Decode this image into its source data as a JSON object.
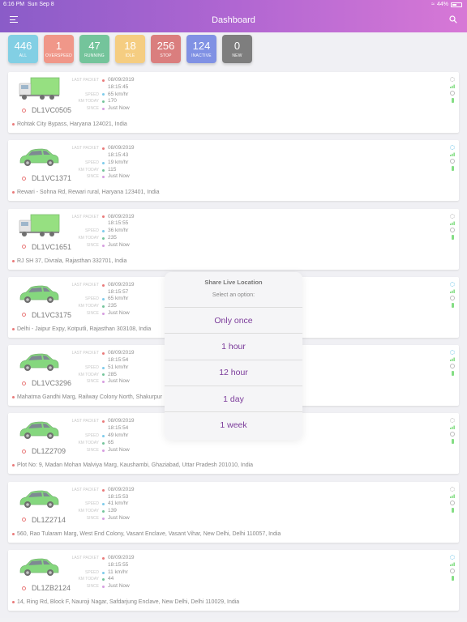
{
  "status": {
    "time": "6:16 PM",
    "date": "Sun Sep 8",
    "battery": "44%"
  },
  "header": {
    "title": "Dashboard"
  },
  "counters": [
    {
      "count": "446",
      "label": "ALL",
      "color": "#3fb6d6"
    },
    {
      "count": "1",
      "label": "OVERSPEED",
      "color": "#e8604a"
    },
    {
      "count": "47",
      "label": "RUNNING",
      "color": "#2aa566"
    },
    {
      "count": "18",
      "label": "IDLE",
      "color": "#f0b33e"
    },
    {
      "count": "256",
      "label": "STOP",
      "color": "#c73a3a"
    },
    {
      "count": "124",
      "label": "INACTIVE",
      "color": "#3d57d6"
    },
    {
      "count": "0",
      "label": "NEW",
      "color": "#3a3a3a"
    }
  ],
  "field_labels": {
    "last_packet": "LAST PACKET",
    "speed": "SPEED",
    "km_today": "KM TODAY",
    "since": "SINCE"
  },
  "vehicles": [
    {
      "type": "truck",
      "plate": "DL1VC0505",
      "date": "08/09/2019",
      "time": "18:15:45",
      "speed": "65 km/hr",
      "km": "170",
      "since": "Just Now",
      "address": "Rohtak City Bypass, Haryana 124021, India",
      "gear_color": "grey"
    },
    {
      "type": "car",
      "plate": "DL1VC1371",
      "date": "08/09/2019",
      "time": "18:15:43",
      "speed": "19 km/hr",
      "km": "115",
      "since": "Just Now",
      "address": "Rewari - Sohna Rd, Rewari rural, Haryana 123401, India",
      "gear_color": "blue"
    },
    {
      "type": "truck",
      "plate": "DL1VC1651",
      "date": "08/09/2019",
      "time": "18:15:55",
      "speed": "36 km/hr",
      "km": "235",
      "since": "Just Now",
      "address": "RJ SH 37, Divrala, Rajasthan 332701, India",
      "gear_color": "grey"
    },
    {
      "type": "car",
      "plate": "DL1VC3175",
      "date": "08/09/2019",
      "time": "18:15:57",
      "speed": "65 km/hr",
      "km": "235",
      "since": "Just Now",
      "address": "Delhi - Jaipur Expy, Kotputli, Rajasthan 303108, India",
      "gear_color": "blue"
    },
    {
      "type": "car",
      "plate": "DL1VC3296",
      "date": "08/09/2019",
      "time": "18:15:54",
      "speed": "51 km/hr",
      "km": "285",
      "since": "Just Now",
      "address": "Mahatma Gandhi Marg, Railway Colony North, Shakurpur",
      "gear_color": "blue"
    },
    {
      "type": "car",
      "plate": "DL1Z2709",
      "date": "08/09/2019",
      "time": "18:15:54",
      "speed": "49 km/hr",
      "km": "65",
      "since": "Just Now",
      "address": "Plot No: 9, Madan Mohan Malviya Marg, Kaushambi, Ghaziabad, Uttar Pradesh 201010, India",
      "gear_color": "grey"
    },
    {
      "type": "car",
      "plate": "DL1Z2714",
      "date": "08/09/2019",
      "time": "18:15:53",
      "speed": "41 km/hr",
      "km": "139",
      "since": "Just Now",
      "address": "560, Rao Tularam Marg, West End Colony, Vasant Enclave, Vasant Vihar, New Delhi, Delhi 110057, India",
      "gear_color": "grey"
    },
    {
      "type": "car",
      "plate": "DL1ZB2124",
      "date": "08/09/2019",
      "time": "18:15:55",
      "speed": "11 km/hr",
      "km": "44",
      "since": "Just Now",
      "address": "14, Ring Rd, Block F, Nauroji Nagar, Safdarjung Enclave, New Delhi, Delhi 110029, India",
      "gear_color": "blue"
    }
  ],
  "dialog": {
    "title": "Share Live Location",
    "subtitle": "Select an option:",
    "options": [
      "Only once",
      "1 hour",
      "12 hour",
      "1 day",
      "1 week"
    ]
  },
  "colors": {
    "accent": "#7b3b9a",
    "header_start": "#8a5cc8",
    "header_end": "#d778d6"
  }
}
